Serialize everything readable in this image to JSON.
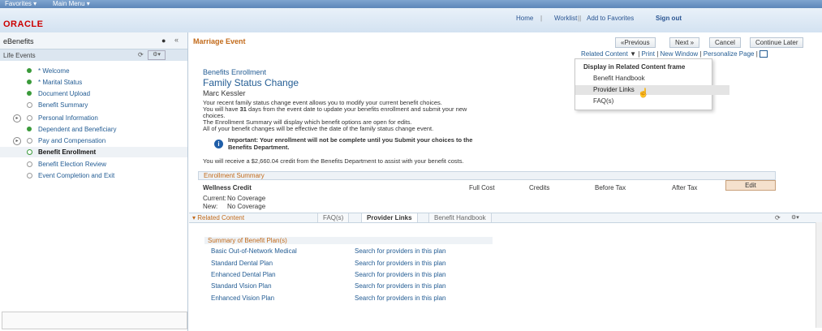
{
  "topbar": {
    "favorites": "Favorites ▾",
    "main_menu": "Main Menu ▾"
  },
  "header": {
    "logo": "ORACLE",
    "home": "Home",
    "worklist": "Worklist",
    "add_favorites": "Add to Favorites",
    "sign_out": "Sign out",
    "sep1": "|",
    "sep2": "||"
  },
  "left": {
    "title": "eBenefits",
    "section": "Life Events",
    "steps": [
      {
        "label": "* Welcome"
      },
      {
        "label": "* Marital Status"
      },
      {
        "label": "Document Upload"
      },
      {
        "label": "Benefit Summary"
      },
      {
        "label": "Personal Information"
      },
      {
        "label": "Dependent and Beneficiary"
      },
      {
        "label": "Pay and Compensation"
      },
      {
        "label": "Benefit Enrollment"
      },
      {
        "label": "Benefit Election Review"
      },
      {
        "label": "Event Completion and Exit"
      }
    ]
  },
  "main": {
    "event_title": "Marriage Event",
    "prev": "«Previous",
    "next": "Next »",
    "cancel": "Cancel",
    "continue_later": "Continue Later",
    "related_content": "Related Content",
    "print": "Print",
    "new_window": "New Window",
    "personalize": "Personalize Page",
    "pipe": "|",
    "section_label": "Benefits Enrollment",
    "page_title": "Family Status Change",
    "person": "Marc Kessler",
    "p1": "Your recent family status change event allows you to modify your current benefit choices.",
    "p2a": "You will have ",
    "p2b": "31",
    "p2c": " days from the event date to update your benefits enrollment and submit your new",
    "p2d": "choices.",
    "p3": "The Enrollment Summary will display which benefit options are open for edits.",
    "p4": "All of your benefit changes will be effective the date of the family status change event.",
    "important": "Important: Your enrollment will not be complete until you Submit your choices to the",
    "important2": "Benefits Department.",
    "credit": "You will receive a $2,660.04 credit from the Benefits Department to assist with your benefit costs.",
    "summary_title": "Enrollment Summary",
    "col_plan": "Wellness Credit",
    "col_full": "Full Cost",
    "col_credits": "Credits",
    "col_before": "Before Tax",
    "col_after": "After Tax",
    "edit": "Edit",
    "current_label": "Current:",
    "current_val": "No Coverage",
    "new_label": "New:",
    "new_val": "No Coverage"
  },
  "dropdown": {
    "header": "Display in Related Content frame",
    "items": [
      "Benefit Handbook",
      "Provider Links",
      "FAQ(s)"
    ]
  },
  "related": {
    "title": "Related Content",
    "tabs": [
      "FAQ(s)",
      "Provider Links",
      "Benefit Handbook"
    ],
    "summary_title": "Summary of Benefit Plan(s)",
    "plans": [
      {
        "name": "Basic Out-of-Network Medical",
        "link": "Search for providers in this plan"
      },
      {
        "name": "Standard Dental Plan",
        "link": "Search for providers in this plan"
      },
      {
        "name": "Enhanced Dental Plan",
        "link": "Search for providers in this plan"
      },
      {
        "name": "Standard Vision Plan",
        "link": "Search for providers in this plan"
      },
      {
        "name": "Enhanced Vision Plan",
        "link": "Search for providers in this plan"
      }
    ]
  }
}
